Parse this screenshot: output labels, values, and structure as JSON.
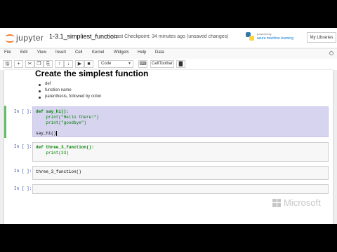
{
  "header": {
    "logo_text": "jupyter",
    "notebook_name": "1-3.1_simpliest_function",
    "checkpoint": "Last Checkpoint: 34 minutes ago (unsaved changes)",
    "azure_powered": "powered by",
    "azure_name": "azure machine learning",
    "libraries_button": "My Libraries"
  },
  "menu": [
    "File",
    "Edit",
    "View",
    "Insert",
    "Cell",
    "Kernel",
    "Widgets",
    "Help",
    "Data"
  ],
  "toolbar": {
    "cell_type": "Code",
    "celltoolbar_label": "CellToolbar"
  },
  "notebook": {
    "markdown": {
      "title": "Create the simplest function",
      "bullets": [
        "def",
        "function name",
        "parenthesis, followed by colon"
      ]
    },
    "cells": [
      {
        "prompt": "In [ ]:",
        "lines": [
          "def say_hi():",
          "    print(\"Hello there!\")",
          "    print(\"goodbye\")",
          "",
          "say_hi()"
        ]
      },
      {
        "prompt": "In [ ]:",
        "lines": [
          "def three_3_function():",
          "    print(33)"
        ]
      },
      {
        "prompt": "In [ ]:",
        "lines": [
          "three_3_function()"
        ]
      },
      {
        "prompt": "In [ ]:",
        "lines": []
      }
    ]
  },
  "watermark": "Microsoft",
  "colors": {
    "jupyter_orange": "#f37726",
    "selected_cell_bar": "#66bb6a",
    "selection_highlight": "#d7d4f0",
    "keyword_green": "#008000",
    "function_blue": "#0000ff",
    "string_red": "#ba2121"
  }
}
